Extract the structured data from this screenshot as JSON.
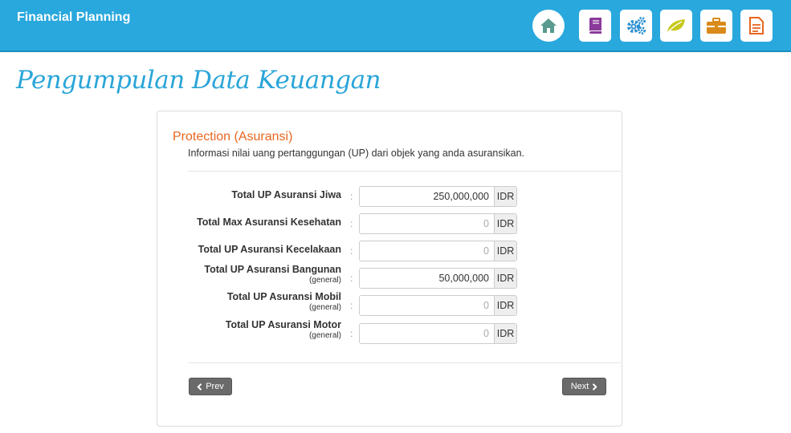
{
  "header": {
    "title": "Financial Planning",
    "nav": [
      {
        "name": "home-icon",
        "color": "#5a9a8f"
      },
      {
        "name": "book-icon",
        "color": "#8a3a9a"
      },
      {
        "name": "gears-icon",
        "color": "#2a8fd0"
      },
      {
        "name": "leaf-icon",
        "color": "#c8c81a"
      },
      {
        "name": "briefcase-icon",
        "color": "#d98a1a"
      },
      {
        "name": "document-icon",
        "color": "#e8661f"
      }
    ]
  },
  "page": {
    "heading": "Pengumpulan Data Keuangan"
  },
  "section": {
    "title": "Protection (Asuransi)",
    "description": "Informasi nilai uang pertanggungan (UP) dari objek yang anda asuransikan."
  },
  "form": {
    "colon": ":",
    "placeholder": "0",
    "fields": [
      {
        "label": "Total UP Asuransi Jiwa",
        "sublabel": "",
        "value": "250,000,000",
        "unit": "IDR"
      },
      {
        "label": "Total Max Asuransi Kesehatan",
        "sublabel": "",
        "value": "",
        "unit": "IDR"
      },
      {
        "label": "Total UP Asuransi Kecelakaan",
        "sublabel": "",
        "value": "",
        "unit": "IDR"
      },
      {
        "label": "Total UP Asuransi Bangunan",
        "sublabel": "(general)",
        "value": "50,000,000",
        "unit": "IDR"
      },
      {
        "label": "Total UP Asuransi Mobil",
        "sublabel": "(general)",
        "value": "",
        "unit": "IDR"
      },
      {
        "label": "Total UP Asuransi Motor",
        "sublabel": "(general)",
        "value": "",
        "unit": "IDR"
      }
    ]
  },
  "buttons": {
    "prev": "Prev",
    "next": "Next"
  }
}
